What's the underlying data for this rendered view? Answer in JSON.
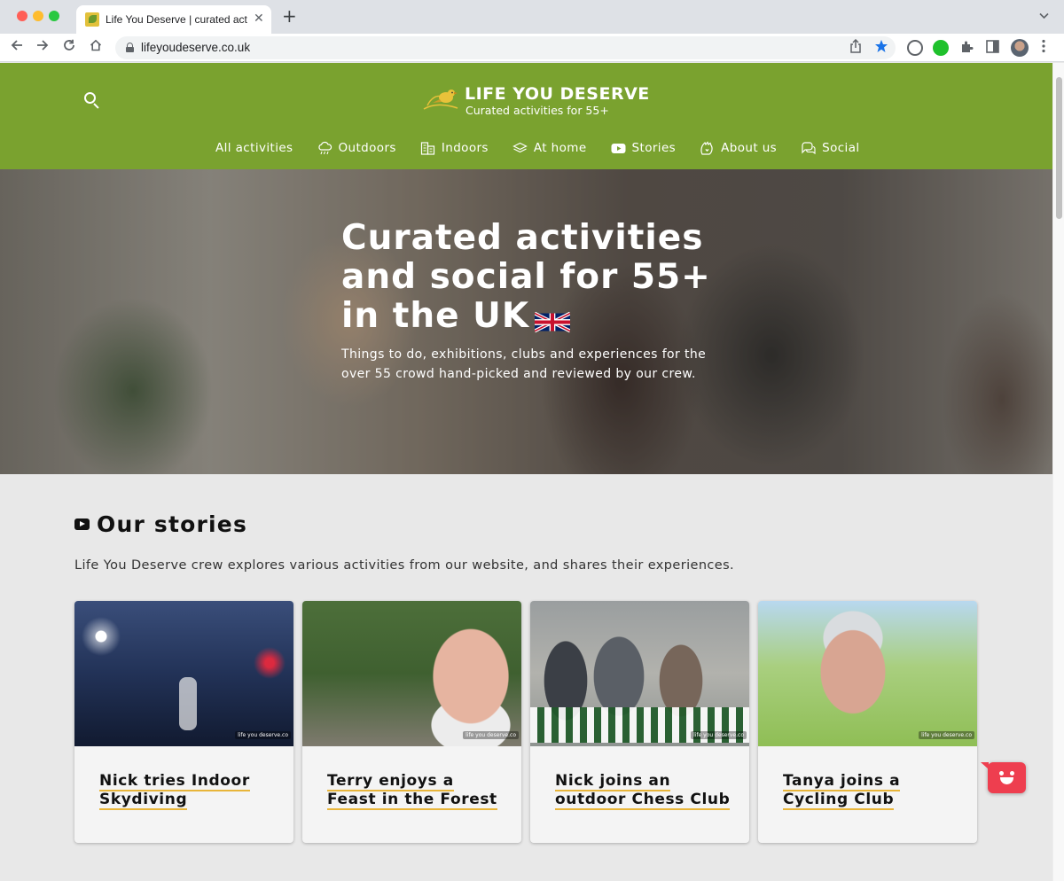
{
  "browser": {
    "tab_title": "Life You Deserve | curated activities",
    "tab_close": "✕",
    "new_tab": "+",
    "url": "lifeyoudeserve.co.uk",
    "icons": [
      "back-icon",
      "forward-icon",
      "reload-icon",
      "home-icon",
      "lock-icon",
      "share-icon",
      "bookmark-star-icon",
      "extensions-icon",
      "sidebar-icon",
      "profile-avatar",
      "menu-icon"
    ]
  },
  "site": {
    "brand": "LIFE YOU DESERVE",
    "tagline": "Curated activities for 55+",
    "colors": {
      "header": "#7aa22f",
      "accent": "#e8b53a",
      "chat": "#ee3e4f"
    }
  },
  "nav": [
    {
      "label": "All activities",
      "icon": ""
    },
    {
      "label": "Outdoors",
      "icon": "cloud-rain-icon"
    },
    {
      "label": "Indoors",
      "icon": "building-icon"
    },
    {
      "label": "At home",
      "icon": "home-stack-icon"
    },
    {
      "label": "Stories",
      "icon": "youtube-icon"
    },
    {
      "label": "About us",
      "icon": "hand-heart-icon"
    },
    {
      "label": "Social",
      "icon": "chat-bubbles-icon"
    }
  ],
  "hero": {
    "title_line1": "Curated activities",
    "title_line2": "and social for 55+",
    "title_line3": "in the UK",
    "subtitle": "Things to do, exhibitions, clubs and experiences for the over 55 crowd hand-picked and reviewed by our crew."
  },
  "stories": {
    "heading": "Our stories",
    "description": "Life You Deserve crew explores various activities from our website, and shares their experiences.",
    "watermark": "life you deserve.co",
    "cards": [
      {
        "title": "Nick tries Indoor Skydiving"
      },
      {
        "title": "Terry enjoys a Feast in the Forest"
      },
      {
        "title": "Nick joins an outdoor Chess Club"
      },
      {
        "title": "Tanya joins a Cycling Club"
      }
    ]
  }
}
